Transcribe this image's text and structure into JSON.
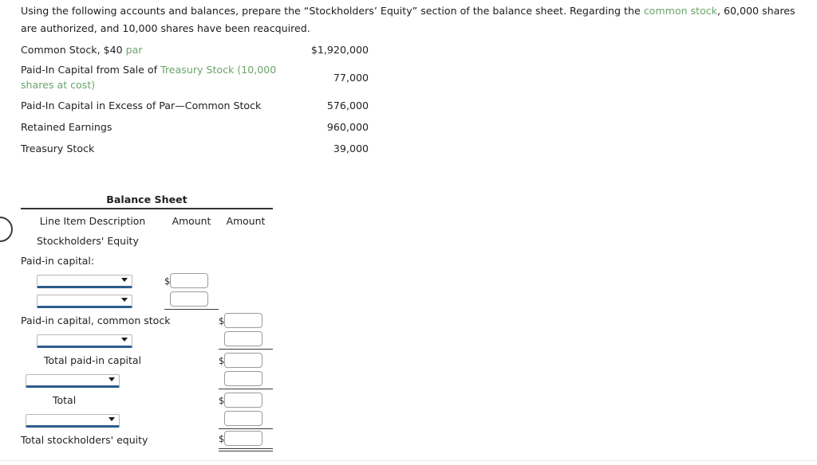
{
  "prompt": {
    "part1": "Using the following accounts and balances, prepare the “Stockholders’ Equity” section of the balance sheet. Regarding the ",
    "link1": "common stock",
    "part2": ", 60,000 shares are authorized, and 10,000 shares have been reacquired."
  },
  "accounts": {
    "rows": [
      {
        "label_plain": "Common Stock, $40 ",
        "label_green": "par",
        "label_tail": "",
        "value": "$1,920,000"
      },
      {
        "label_plain": "Paid-In Capital from Sale of ",
        "label_green": "Treasury Stock (10,000 shares at cost)",
        "label_tail": "",
        "value": "77,000"
      },
      {
        "label_plain": "Paid-In Capital in Excess of Par—Common Stock",
        "label_green": "",
        "label_tail": "",
        "value": "576,000"
      },
      {
        "label_plain": "Retained Earnings",
        "label_green": "",
        "label_tail": "",
        "value": "960,000"
      },
      {
        "label_plain": "Treasury Stock",
        "label_green": "",
        "label_tail": "",
        "value": "39,000"
      }
    ]
  },
  "sheet": {
    "title": "Balance Sheet",
    "headers": {
      "description": "Line Item Description",
      "amount1": "Amount",
      "amount2": "Amount"
    },
    "rows": {
      "stockholders_equity": "Stockholders' Equity",
      "paid_in_capital": "Paid-in capital:",
      "paid_in_capital_common_stock": "Paid-in capital, common stock",
      "total_paid_in_capital": "Total paid-in capital",
      "total": "Total",
      "total_stockholders_equity": "Total stockholders' equity"
    },
    "selects": {
      "select1": "",
      "select2": "",
      "select3": "",
      "select4": "",
      "select5": ""
    },
    "inputs": {
      "input1": "",
      "input2": "",
      "input3": "",
      "input4": "",
      "input5": "",
      "input6": "",
      "input7": "",
      "input8": "",
      "input9": ""
    },
    "currency_symbol": "$"
  },
  "colors": {
    "link_green": "#6aa46a",
    "select_underline": "#2e5c8a",
    "text": "#222222"
  },
  "icons": {
    "help_circle": "help-circle-icon",
    "dropdown_caret": "chevron-down-icon"
  }
}
